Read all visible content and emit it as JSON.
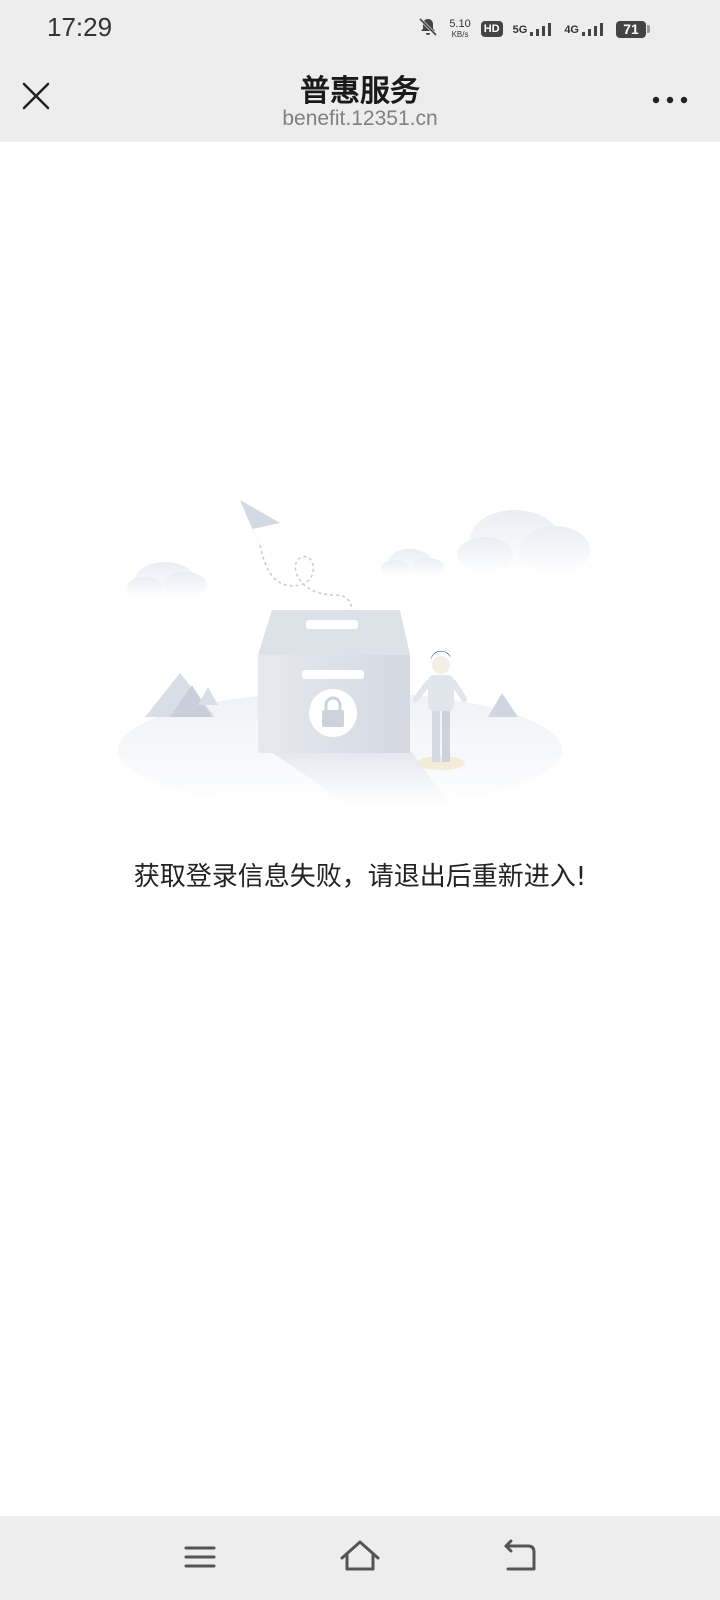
{
  "status_bar": {
    "time": "17:29",
    "net_speed_value": "5.10",
    "net_speed_unit": "KB/s",
    "hd_label": "HD",
    "net_5g": "5G",
    "net_4g": "4G",
    "battery_level": "71",
    "icons": [
      "bell-off-icon",
      "hd-icon",
      "signal-5g-icon",
      "signal-4g-icon",
      "battery-icon"
    ]
  },
  "nav": {
    "title": "普惠服务",
    "subtitle": "benefit.12351.cn",
    "close_icon": "close-icon",
    "more_icon": "more-icon"
  },
  "content": {
    "illustration": "locked-box-illustration",
    "message": "获取登录信息失败，请退出后重新进入!"
  },
  "system_nav": {
    "icons": [
      "menu-icon",
      "home-icon",
      "back-icon"
    ]
  },
  "colors": {
    "bar_background": "#ededed",
    "page_background": "#ffffff",
    "text_primary": "#222222",
    "text_secondary": "#808080"
  }
}
